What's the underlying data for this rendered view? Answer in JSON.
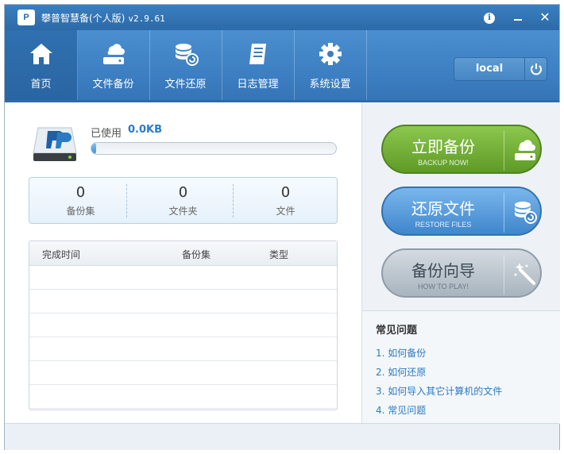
{
  "titlebar": {
    "logo_text": "P",
    "app_name": "攀普智慧备(个人版)",
    "version": "v2.9.61",
    "info_symbol": "i",
    "close_symbol": "✕"
  },
  "nav": {
    "items": [
      {
        "label": "首页",
        "icon": "home-icon"
      },
      {
        "label": "文件备份",
        "icon": "cloud-drive-icon"
      },
      {
        "label": "文件还原",
        "icon": "database-restore-icon"
      },
      {
        "label": "日志管理",
        "icon": "log-document-icon"
      },
      {
        "label": "系统设置",
        "icon": "gear-icon"
      }
    ],
    "active_index": 0,
    "account_label": "local",
    "power_icon": "power-icon"
  },
  "storage": {
    "used_label": "已使用",
    "used_value": "0.0KB",
    "progress_fraction": 0.02
  },
  "stats": [
    {
      "value": "0",
      "label": "备份集"
    },
    {
      "value": "0",
      "label": "文件夹"
    },
    {
      "value": "0",
      "label": "文件"
    }
  ],
  "table": {
    "columns": [
      "完成时间",
      "备份集",
      "类型"
    ],
    "rows": []
  },
  "actions": {
    "backup": {
      "label": "立即备份",
      "sub": "BACKUP NOW!",
      "icon": "cloud-drive-icon",
      "color": "#6aa932"
    },
    "restore": {
      "label": "还原文件",
      "sub": "RESTORE FILES",
      "icon": "database-restore-icon",
      "color": "#4a8fd3"
    },
    "guide": {
      "label": "备份向导",
      "sub": "HOW TO PLAY!",
      "icon": "magic-wand-icon",
      "color": "#b3bec7"
    }
  },
  "faq": {
    "title": "常见问题",
    "items": [
      "1. 如何备份",
      "2. 如何还原",
      "3. 如何导入其它计算机的文件",
      "4. 常见问题"
    ]
  },
  "colors": {
    "title_bar": "#3b7fc0",
    "nav_bar": "#4b8fd0",
    "accent_link": "#2b7bc4"
  }
}
